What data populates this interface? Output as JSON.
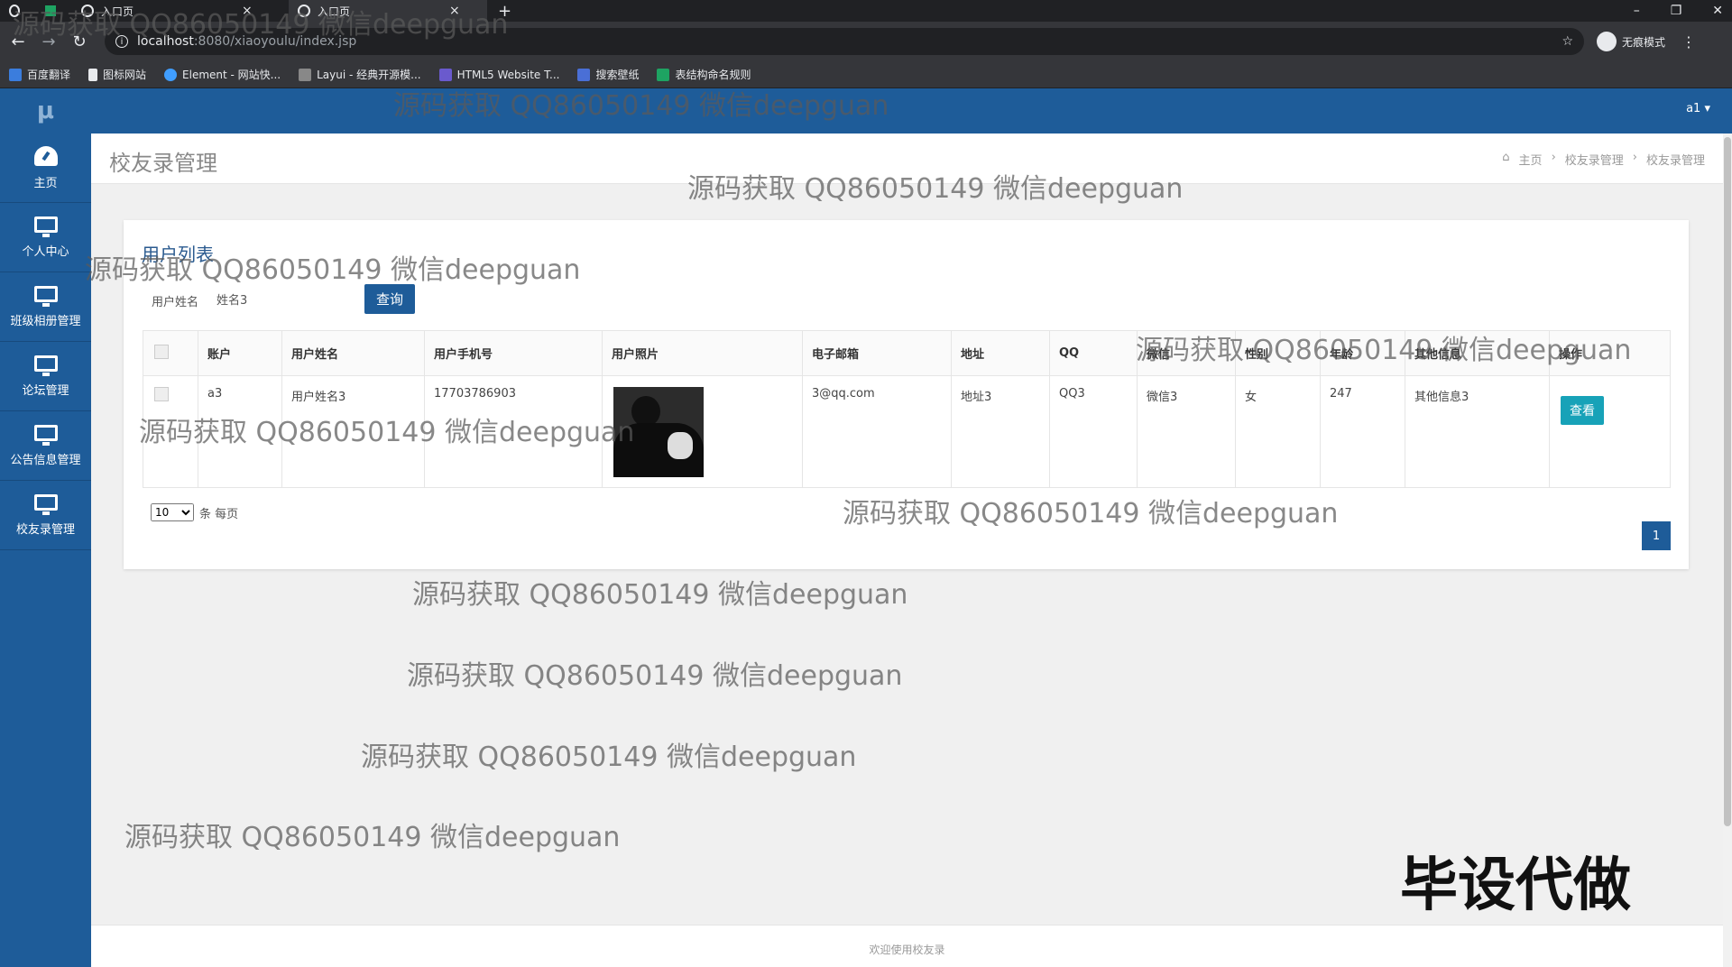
{
  "browser": {
    "tabs": [
      {
        "title": ""
      },
      {
        "title": "入口页"
      },
      {
        "title": "入口页"
      }
    ],
    "new_tab": "+",
    "url_host": "localhost",
    "url_path": ":8080/xiaoyoulu/index.jsp",
    "profile": "无痕模式",
    "bookmarks": [
      "百度翻译",
      "图标网站",
      "Element - 网站快...",
      "Layui - 经典开源模...",
      "HTML5 Website T...",
      "搜索壁纸",
      "表结构命名规则"
    ]
  },
  "app": {
    "logo": "μ",
    "user": "a1 ▾",
    "nav": [
      {
        "label": "主页",
        "icon": "dashboard-icon"
      },
      {
        "label": "个人中心",
        "icon": "monitor-icon"
      },
      {
        "label": "班级相册管理",
        "icon": "monitor-icon"
      },
      {
        "label": "论坛管理",
        "icon": "monitor-icon"
      },
      {
        "label": "公告信息管理",
        "icon": "monitor-icon"
      },
      {
        "label": "校友录管理",
        "icon": "monitor-icon"
      }
    ]
  },
  "page": {
    "title": "校友录管理",
    "breadcrumb": [
      "主页",
      "校友录管理",
      "校友录管理"
    ],
    "card_title": "用户列表",
    "search_label": "用户姓名",
    "search_value": "姓名3",
    "search_button": "查询"
  },
  "table": {
    "headers": [
      "账户",
      "用户姓名",
      "用户手机号",
      "用户照片",
      "电子邮箱",
      "地址",
      "QQ",
      "微信",
      "性别",
      "年龄",
      "其他信息",
      "操作"
    ],
    "rows": [
      {
        "account": "a3",
        "name": "用户姓名3",
        "phone": "17703786903",
        "email": "3@qq.com",
        "address": "地址3",
        "qq": "QQ3",
        "wechat": "微信3",
        "gender": "女",
        "age": "247",
        "other": "其他信息3",
        "action": "查看"
      }
    ]
  },
  "pagination": {
    "per_page": "10",
    "per_page_suffix": "条 每页",
    "current_page": "1"
  },
  "footer": "欢迎使用校友录",
  "watermark": "源码获取 QQ86050149 微信deepguan",
  "overlay_text": "毕设代做"
}
